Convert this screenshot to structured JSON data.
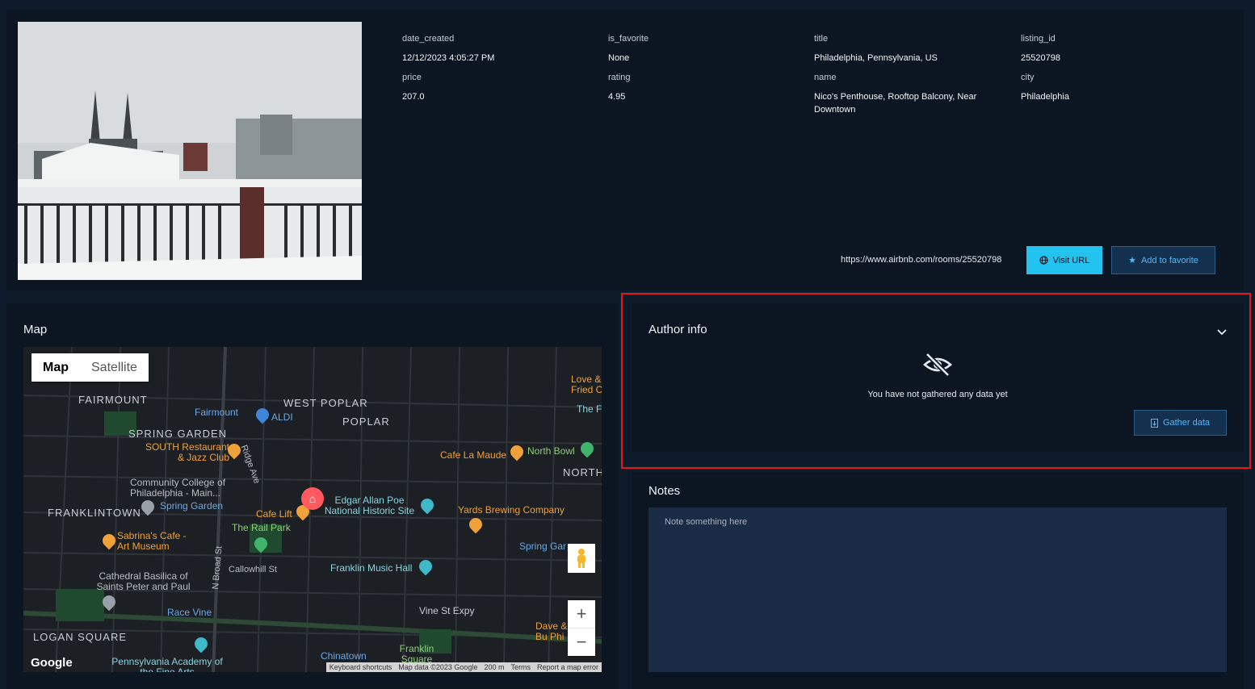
{
  "listing": {
    "fields": [
      {
        "key": "date_created",
        "value": "12/12/2023 4:05:27 PM"
      },
      {
        "key": "is_favorite",
        "value": "None"
      },
      {
        "key": "title",
        "value": "Philadelphia, Pennsylvania, US"
      },
      {
        "key": "listing_id",
        "value": "25520798"
      },
      {
        "key": "price",
        "value": "207.0"
      },
      {
        "key": "rating",
        "value": "4.95"
      },
      {
        "key": "name",
        "value": "Nico's Penthouse, Rooftop Balcony, Near Downtown"
      },
      {
        "key": "city",
        "value": "Philadelphia"
      }
    ],
    "url": "https://www.airbnb.com/rooms/25520798",
    "visit_url_label": "Visit URL",
    "add_favorite_label": "Add to favorite"
  },
  "map": {
    "title": "Map",
    "type_map": "Map",
    "type_satellite": "Satellite",
    "labels": {
      "fairmount": "FAIRMOUNT",
      "west_poplar": "WEST POPLAR",
      "poplar": "POPLAR",
      "spring_garden": "SPRING GARDEN",
      "franklintown": "FRANKLINTOWN",
      "logan_square": "LOGAN SQUARE",
      "north_liberties": "NORTH LIBERT",
      "south_restaurant": "SOUTH Restaurant & Jazz Club",
      "fairmount_station": "Fairmount",
      "aldi": "ALDI",
      "cafe_la_maude": "Cafe La Maude",
      "north_bowl": "North Bowl",
      "community_college": "Community College of Philadelphia - Main...",
      "spring_garden_station": "Spring Garden",
      "cafe_lift": "Cafe Lift",
      "edgar_allan_poe": "Edgar Allan Poe National Historic Site",
      "yards": "Yards Brewing Company",
      "rail_park": "The Rail Park",
      "sabrinas": "Sabrina's Cafe - Art Museum",
      "franklin_music_hall": "Franklin Music Hall",
      "cathedral": "Cathedral Basilica of Saints Peter and Paul",
      "race_vine": "Race Vine",
      "vine_st_expy": "Vine St Expy",
      "chinatown": "Chinatown",
      "franklin_square": "Franklin Square",
      "penn_academy": "Pennsylvania Academy of the Fine Arts",
      "love_fried": "Love & Fried C",
      "the_f": "The F",
      "callowhill": "Callowhill St",
      "ridge_ave": "Ridge Ave",
      "n_broad": "N Broad St",
      "spring_garden_right": "Spring Gard",
      "dave": "Dave & Bu Phi"
    },
    "google_logo": "Google",
    "attribution": [
      "Keyboard shortcuts",
      "Map data ©2023 Google",
      "200 m",
      "Terms",
      "Report a map error"
    ]
  },
  "author": {
    "title": "Author info",
    "empty_text": "You have not gathered any data yet",
    "gather_label": "Gather data"
  },
  "notes": {
    "title": "Notes",
    "placeholder": "Note something here"
  },
  "colors": {
    "accent": "#22c4ef",
    "highlight": "#e01b1b",
    "panel": "#0c1623"
  }
}
